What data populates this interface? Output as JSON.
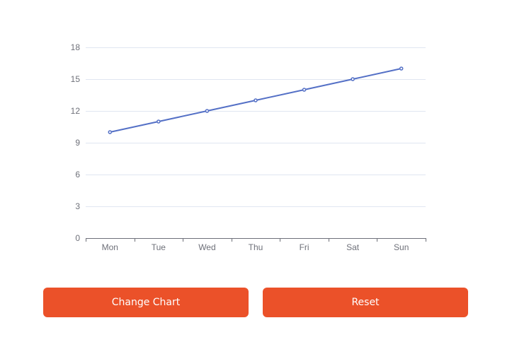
{
  "chart_data": {
    "type": "line",
    "categories": [
      "Mon",
      "Tue",
      "Wed",
      "Thu",
      "Fri",
      "Sat",
      "Sun"
    ],
    "series": [
      {
        "values": [
          10,
          11,
          12,
          13,
          14,
          15,
          16
        ]
      }
    ],
    "yticks": [
      0,
      3,
      6,
      9,
      12,
      15,
      18
    ],
    "ylim": [
      0,
      18
    ],
    "grid": true,
    "title": "",
    "xlabel": "",
    "ylabel": ""
  },
  "buttons": {
    "change_label": "Change Chart",
    "reset_label": "Reset"
  },
  "colors": {
    "line": "#5470c6",
    "button": "#eb5129",
    "grid": "#e0e6f1",
    "axis": "#6e7079",
    "tick_label": "#6e7079"
  }
}
